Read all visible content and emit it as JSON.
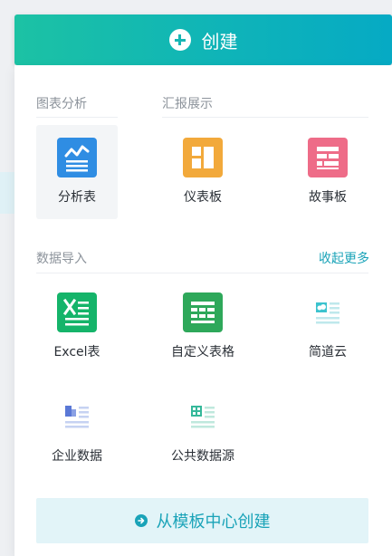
{
  "header": {
    "create_label": "创建"
  },
  "sections": {
    "chart_analysis": "图表分析",
    "report_display": "汇报展示",
    "data_import": "数据导入",
    "collapse_more": "收起更多"
  },
  "tiles": {
    "analysis_table": "分析表",
    "dashboard": "仪表板",
    "storyboard": "故事板",
    "excel": "Excel表",
    "custom_table": "自定义表格",
    "jiandao_cloud": "简道云",
    "enterprise_data": "企业数据",
    "public_data": "公共数据源"
  },
  "footer": {
    "template_center_label": "从模板中心创建"
  },
  "colors": {
    "accent": "#17b6b4",
    "analysis_icon": "#2f8de3",
    "dashboard_icon": "#f2a93b",
    "storyboard_icon": "#ee6c88",
    "excel_icon": "#15b46a",
    "custom_table_icon": "#2ea85a"
  }
}
